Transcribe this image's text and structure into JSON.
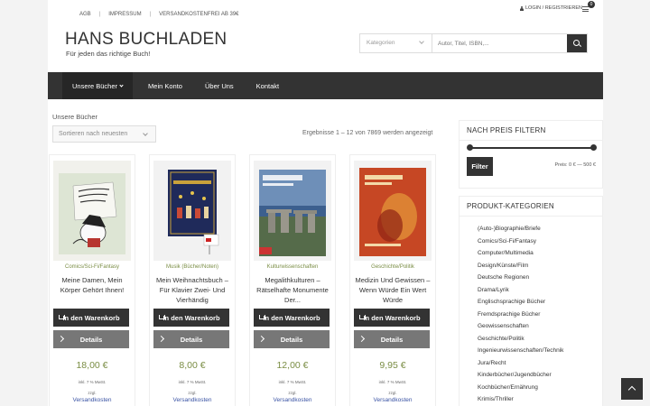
{
  "topbar": {
    "links": [
      "AGB",
      "IMPRESSUM",
      "VERSANDKOSTENFREI AB 39€"
    ],
    "login_label": "LOGIN / REGISTRIEREN",
    "cart_count": "0"
  },
  "header": {
    "site_title": "HANS BUCHLADEN",
    "tagline": "Für jeden das richtige Buch!"
  },
  "search": {
    "category_placeholder": "Kategorien",
    "input_placeholder": "Autor, Titel, ISBN,..."
  },
  "nav": {
    "items": [
      "Unsere Bücher",
      "Mein Konto",
      "Über Uns",
      "Kontakt"
    ]
  },
  "main": {
    "section_title": "Unsere Bücher",
    "sort_selected": "Sortieren nach neuesten",
    "results_text": "Ergebnisse 1 – 12 von 7869 werden angezeigt"
  },
  "products": [
    {
      "category": "Comics/Sci-Fi/Fantasy",
      "title": "Meine Damen, Mein Körper Gehört Ihnen!",
      "cart_label": "In den Warenkorb",
      "details_label": "Details",
      "price": "18,00 €",
      "tax": "inkl. 7 % MwSt.",
      "zzgl": "zzgl.",
      "shipping": "Versandkosten"
    },
    {
      "category": "Musik (Bücher/Noten)",
      "title": "Mein Weihnachtsbuch – Für Klavier Zwei- Und Vierhändig",
      "cart_label": "In den Warenkorb",
      "details_label": "Details",
      "price": "8,00 €",
      "tax": "inkl. 7 % MwSt.",
      "zzgl": "zzgl.",
      "shipping": "Versandkosten"
    },
    {
      "category": "Kulturwissenschaften",
      "title": "Megalithkulturen – Rätselhafte Monumente Der...",
      "cart_label": "In den Warenkorb",
      "details_label": "Details",
      "price": "12,00 €",
      "tax": "inkl. 7 % MwSt.",
      "zzgl": "zzgl.",
      "shipping": "Versandkosten"
    },
    {
      "category": "Geschichte/Politik",
      "title": "Medizin Und Gewissen – Wenn Würde Ein Wert Würde",
      "cart_label": "In den Warenkorb",
      "details_label": "Details",
      "price": "9,95 €",
      "tax": "inkl. 7 % MwSt.",
      "zzgl": "zzgl.",
      "shipping": "Versandkosten"
    }
  ],
  "price_filter": {
    "title": "NACH PREIS FILTERN",
    "button_label": "Filter",
    "range_text": "Preis: 0 € — 500 €"
  },
  "categories": {
    "title": "PRODUKT-KATEGORIEN",
    "items": [
      "(Auto-)Biographie/Briefe",
      "Comics/Sci-Fi/Fantasy",
      "Computer/Multimedia",
      "Design/Künste/Film",
      "Deutsche Regionen",
      "Drama/Lyrik",
      "Englischsprachige Bücher",
      "Fremdsprachige Bücher",
      "Geowissenschaften",
      "Geschichte/Politik",
      "Ingenieurwissenschaften/Technik",
      "Jura/Recht",
      "Kinderbücher/Jugendbücher",
      "Kochbücher/Ernährung",
      "Krimis/Thriller"
    ]
  },
  "colors": {
    "accent_green": "#7a8d44",
    "dark": "#333333",
    "link_blue": "#3a53a4"
  }
}
